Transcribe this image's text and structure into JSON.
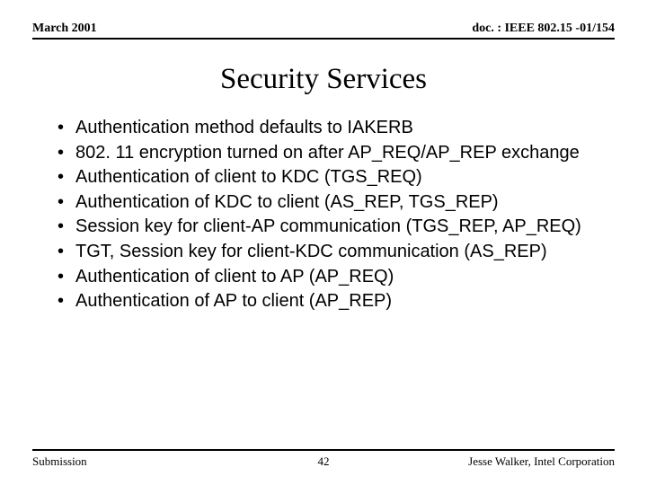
{
  "header": {
    "left": "March 2001",
    "right": "doc. : IEEE 802.15 -01/154"
  },
  "title": "Security Services",
  "bullets": [
    "Authentication method defaults to IAKERB",
    "802. 11 encryption turned on after AP_REQ/AP_REP exchange",
    "Authentication of client to KDC (TGS_REQ)",
    "Authentication of KDC to client (AS_REP, TGS_REP)",
    "Session key for client-AP communication (TGS_REP, AP_REQ)",
    "TGT, Session key for client-KDC communication (AS_REP)",
    "Authentication of client to AP (AP_REQ)",
    "Authentication of AP to client (AP_REP)"
  ],
  "footer": {
    "left": "Submission",
    "center": "42",
    "right": "Jesse Walker, Intel Corporation"
  }
}
